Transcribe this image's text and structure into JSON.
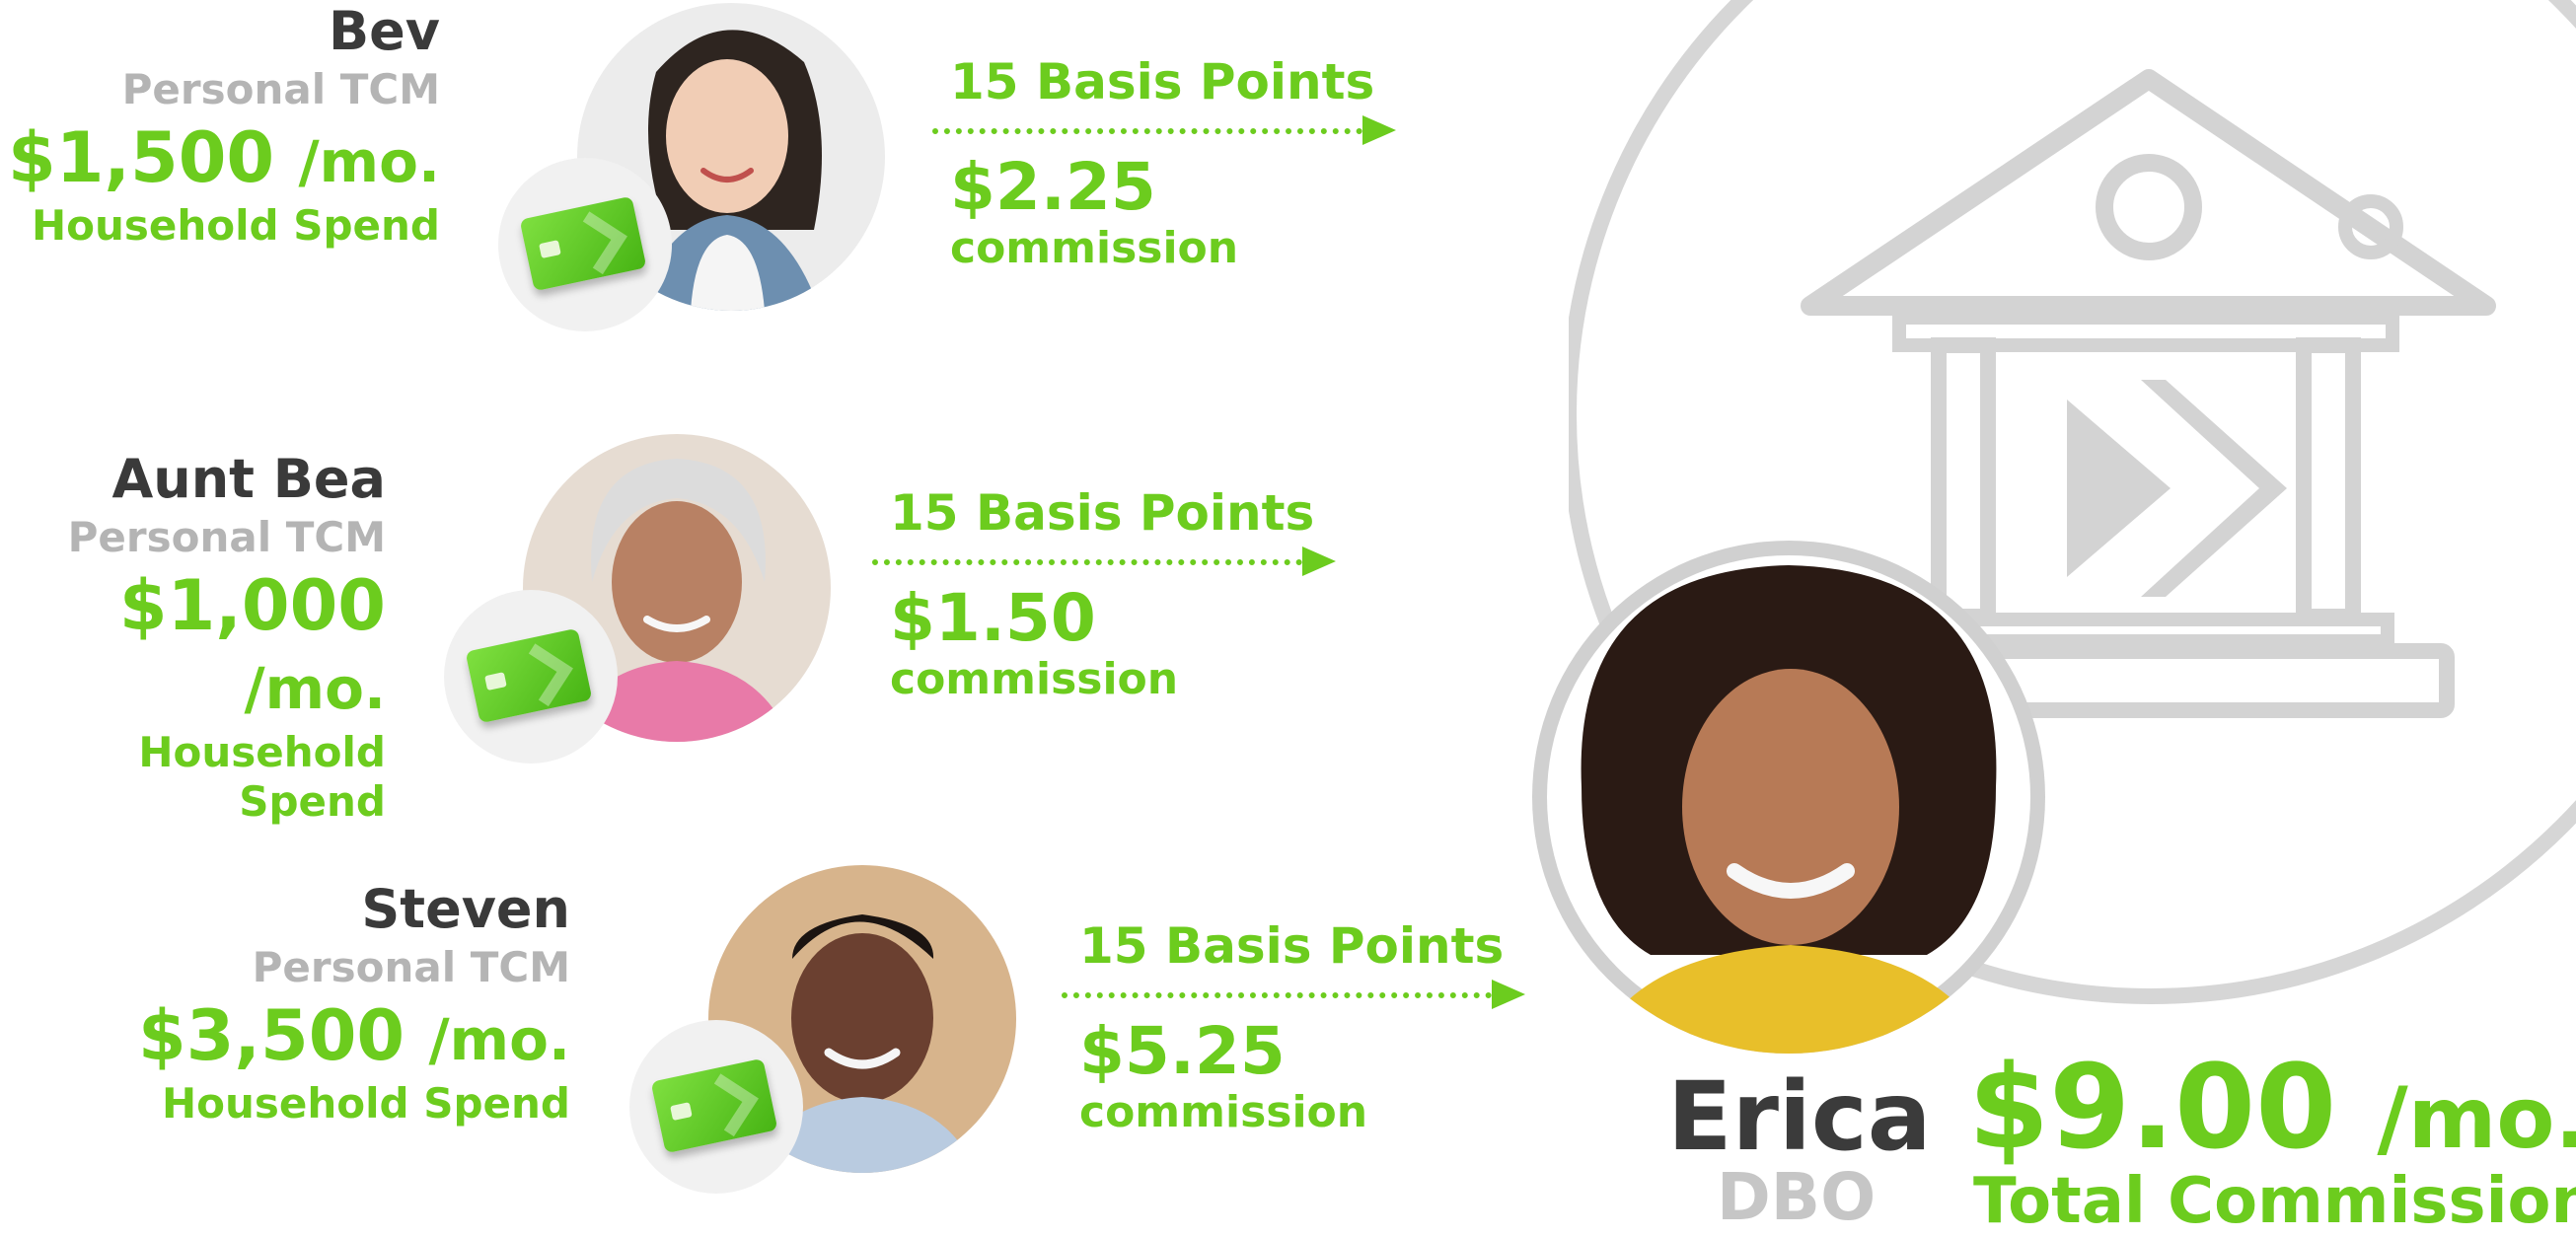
{
  "people": [
    {
      "name": "Bev",
      "role": "Personal TCM",
      "amount": "$1,500",
      "unit": "/mo.",
      "spend_label": "Household Spend",
      "basis_points": "15 Basis Points",
      "commission": "$2.25",
      "commission_label": "commission"
    },
    {
      "name": "Aunt Bea",
      "role": "Personal TCM",
      "amount": "$1,000",
      "unit": "/mo.",
      "spend_label": "Household Spend",
      "basis_points": "15 Basis Points",
      "commission": "$1.50",
      "commission_label": "commission"
    },
    {
      "name": "Steven",
      "role": "Personal TCM",
      "amount": "$3,500",
      "unit": "/mo.",
      "spend_label": "Household Spend",
      "basis_points": "15 Basis Points",
      "commission": "$5.25",
      "commission_label": "commission"
    }
  ],
  "dbo": {
    "name": "Erica",
    "role": "DBO",
    "total": "$9.00",
    "unit": "/mo.",
    "total_label": "Total Commissions"
  },
  "icons": {
    "bank": "bank-icon",
    "card": "credit-card-icon"
  },
  "colors": {
    "accent": "#6ccc1e",
    "name_text": "#3a3a3a",
    "muted_text": "#b4b4b4",
    "icon_gray": "#d3d3d3"
  }
}
